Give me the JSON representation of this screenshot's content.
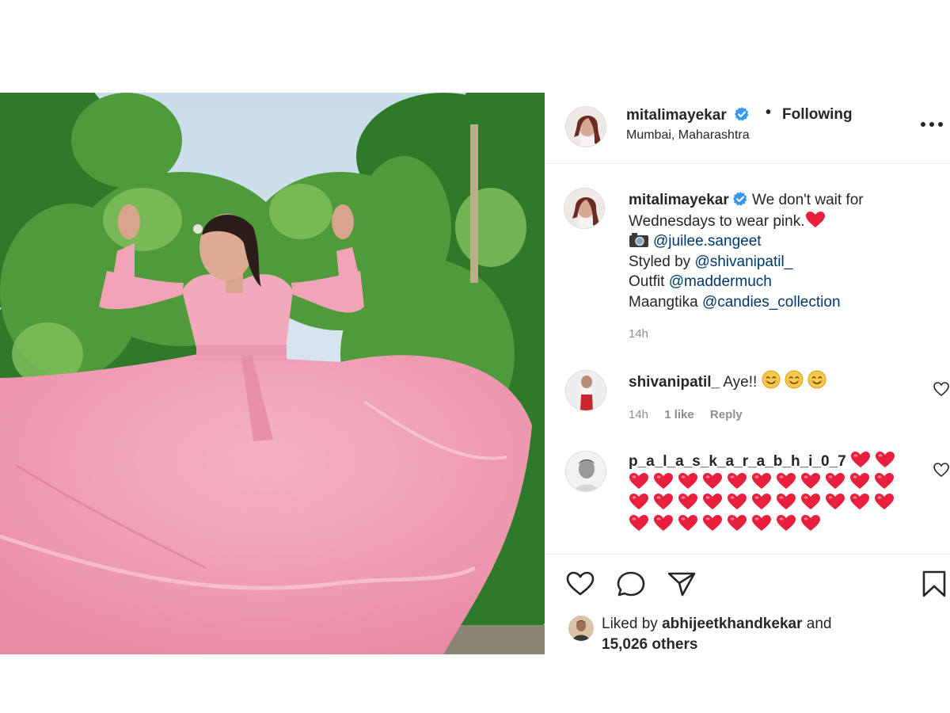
{
  "post": {
    "username": "mitalimayekar",
    "follow_state": "Following",
    "separator": "•",
    "location": "Mumbai, Maharashtra"
  },
  "caption": {
    "username": "mitalimayekar",
    "line1": "We don't wait for Wednesdays to wear pink.",
    "photo_credit": "@juilee.sangeet",
    "styled_label": "Styled by",
    "styled_by": "@shivanipatil_",
    "outfit_label": "Outfit",
    "outfit_by": "@maddermuch",
    "maangtika_label": "Maangtika",
    "maangtika_by": "@candies_collection",
    "time": "14h"
  },
  "comments": [
    {
      "username": "shivanipatil_",
      "text": "Aye!!",
      "emoji_count": 3,
      "time": "14h",
      "likes": "1 like",
      "reply": "Reply"
    },
    {
      "username": "p_a_l_a_s_k_a_r_a_b_h_i_0_7",
      "heart_count": 32
    }
  ],
  "likes": {
    "prefix": "Liked by",
    "user": "abhijeetkhandkekar",
    "and": "and",
    "others": "15,026 others"
  },
  "icons": {
    "verified": "verified-badge-icon",
    "more": "more-options-icon",
    "like": "heart-icon",
    "comment": "comment-bubble-icon",
    "share": "paper-plane-icon",
    "save": "bookmark-icon"
  },
  "colors": {
    "verified_blue": "#3897f0",
    "link": "#00376b",
    "muted": "#8e8e8e",
    "dress_pink": "#f2a0b6",
    "heart_red": "#e8203d"
  }
}
